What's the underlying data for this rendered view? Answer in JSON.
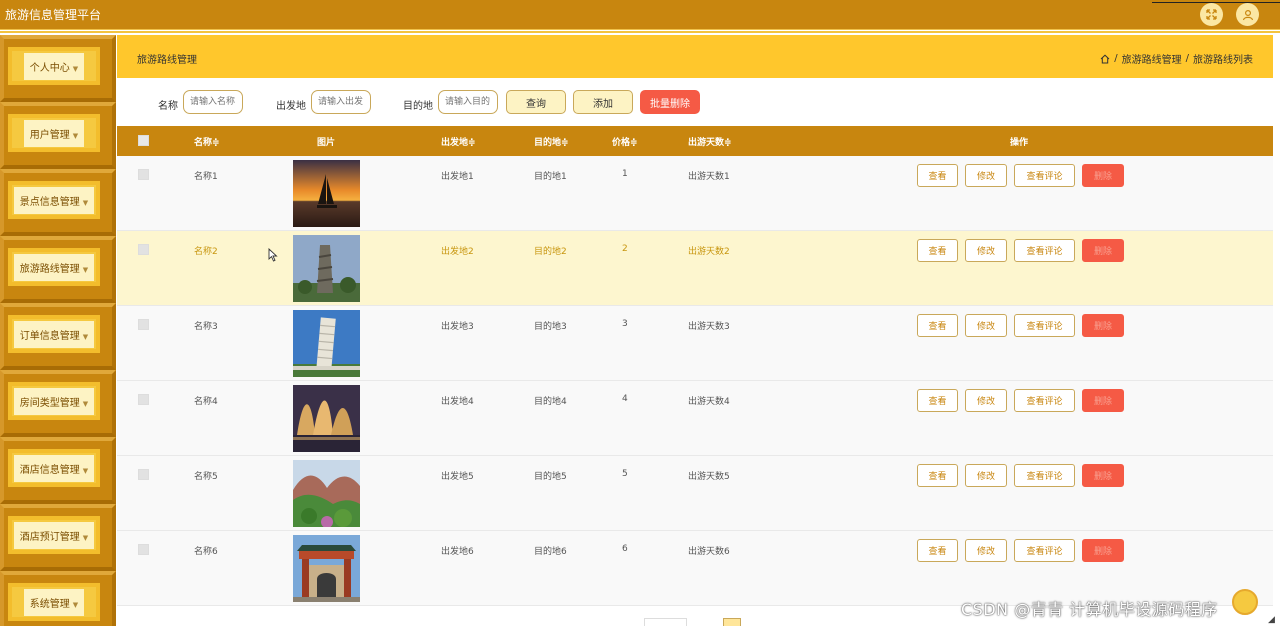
{
  "app": {
    "title": "旅游信息管理平台"
  },
  "sidebar": {
    "items": [
      {
        "label": "个人中心"
      },
      {
        "label": "用户管理"
      },
      {
        "label": "景点信息管理"
      },
      {
        "label": "旅游路线管理"
      },
      {
        "label": "订单信息管理"
      },
      {
        "label": "房间类型管理"
      },
      {
        "label": "酒店信息管理"
      },
      {
        "label": "酒店预订管理"
      },
      {
        "label": "系统管理"
      }
    ]
  },
  "header": {
    "page_title": "旅游路线管理",
    "breadcrumb": [
      "旅游路线管理",
      "旅游路线列表"
    ],
    "separator": "/"
  },
  "search": {
    "name_label": "名称",
    "name_placeholder": "请输入名称",
    "origin_label": "出发地",
    "origin_placeholder": "请输入出发",
    "dest_label": "目的地",
    "dest_placeholder": "请输入目的",
    "query_label": "查询",
    "add_label": "添加",
    "batch_delete_label": "批量删除"
  },
  "table": {
    "columns": [
      "名称≑",
      "图片",
      "出发地≑",
      "目的地≑",
      "价格≑",
      "出游天数≑",
      "操作"
    ],
    "actions": {
      "view": "查看",
      "edit": "修改",
      "view_comments": "查看评论",
      "delete": "删除"
    },
    "rows": [
      {
        "name": "名称1",
        "origin": "出发地1",
        "dest": "目的地1",
        "price": "1",
        "days": "出游天数1",
        "image": "sailboat-sunset"
      },
      {
        "name": "名称2",
        "origin": "出发地2",
        "dest": "目的地2",
        "price": "2",
        "days": "出游天数2",
        "image": "stone-tower"
      },
      {
        "name": "名称3",
        "origin": "出发地3",
        "dest": "目的地3",
        "price": "3",
        "days": "出游天数3",
        "image": "leaning-tower"
      },
      {
        "name": "名称4",
        "origin": "出发地4",
        "dest": "目的地4",
        "price": "4",
        "days": "出游天数4",
        "image": "opera-house-night"
      },
      {
        "name": "名称5",
        "origin": "出发地5",
        "dest": "目的地5",
        "price": "5",
        "days": "出游天数5",
        "image": "mountain-cliff"
      },
      {
        "name": "名称6",
        "origin": "出发地6",
        "dest": "目的地6",
        "price": "6",
        "days": "出游天数6",
        "image": "chinese-gate"
      }
    ]
  },
  "watermark": "CSDN @青青  计算机毕设源码程序",
  "icons": {
    "fullscreen": "expand-icon",
    "user": "user-icon",
    "home": "home-icon"
  },
  "colors": {
    "brand": "#c8860f",
    "accent": "#ffc72c",
    "danger": "#f55a45",
    "highlight": "#fdf6cf"
  }
}
